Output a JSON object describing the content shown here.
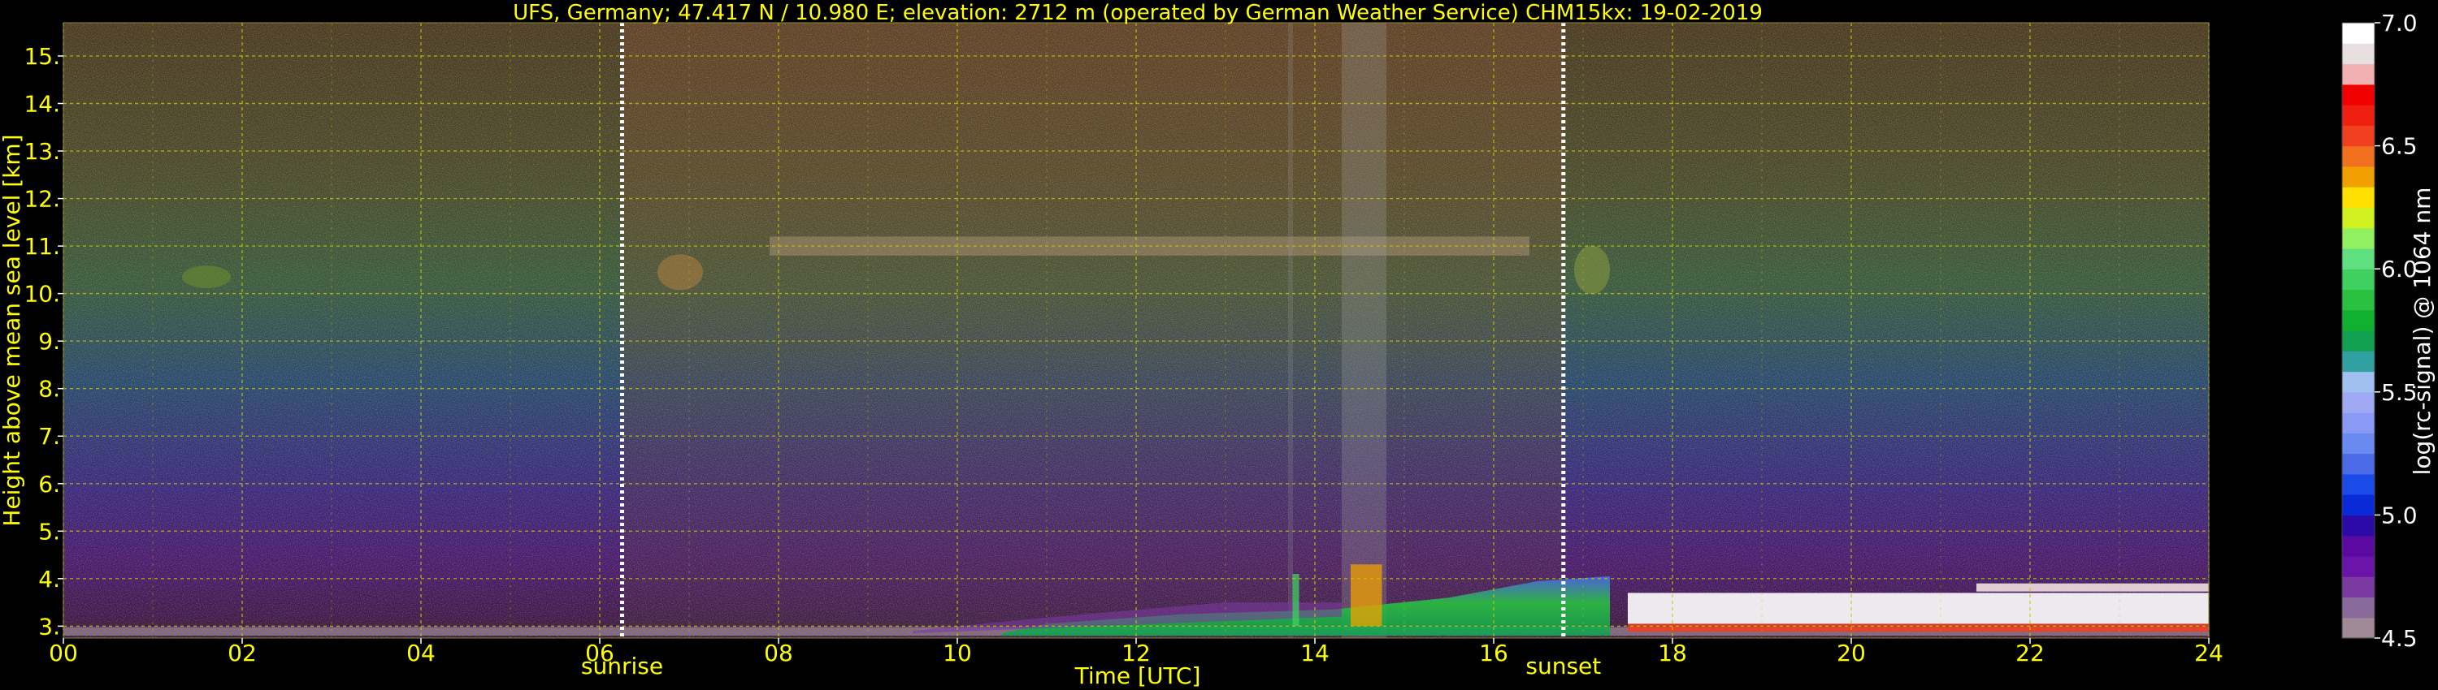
{
  "chart_data": {
    "type": "heatmap",
    "title": "UFS, Germany; 47.417 N / 10.980 E; elevation: 2712 m  (operated by German Weather Service)    CHM15kx: 19-02-2019",
    "xlabel": "Time [UTC]",
    "ylabel": "Height above mean sea level [km]",
    "colorbar_label": "log(rc-signal) @ 1064 nm",
    "xlim": [
      0,
      24
    ],
    "ylim": [
      2.75,
      15.7
    ],
    "x_ticks": [
      0,
      2,
      4,
      6,
      8,
      10,
      12,
      14,
      16,
      18,
      20,
      22,
      24
    ],
    "x_tick_labels": [
      "00",
      "02",
      "04",
      "06",
      "08",
      "10",
      "12",
      "14",
      "16",
      "18",
      "20",
      "22",
      "24"
    ],
    "y_ticks": [
      3,
      4,
      5,
      6,
      7,
      8,
      9,
      10,
      11,
      12,
      13,
      14,
      15
    ],
    "y_tick_labels": [
      "3.",
      "4.",
      "5.",
      "6.",
      "7.",
      "8.",
      "9.",
      "10.",
      "11.",
      "12.",
      "13.",
      "14.",
      "15."
    ],
    "colorbar_range": [
      4.5,
      7.0
    ],
    "colorbar_ticks": [
      4.5,
      5.0,
      5.5,
      6.0,
      6.5,
      7.0
    ],
    "colorbar_tick_labels": [
      "4.5",
      "5.0",
      "5.5",
      "6.0",
      "6.5",
      "7.0"
    ],
    "colormap": [
      "#a08a98",
      "#8a6a9a",
      "#7a3aa0",
      "#6a14a8",
      "#5a0aa0",
      "#2c0aa8",
      "#0a2ad8",
      "#1a4ae8",
      "#4a6ae8",
      "#6a8af0",
      "#8a9af4",
      "#a0aaf4",
      "#a0c0f0",
      "#30a0a0",
      "#10a050",
      "#10b030",
      "#2ac040",
      "#40d060",
      "#60e080",
      "#90f060",
      "#d0f020",
      "#ffe000",
      "#f0a000",
      "#f07020",
      "#f04020",
      "#f02010",
      "#f00000",
      "#f0b0b0",
      "#e8e0e0",
      "#ffffff"
    ],
    "sunrise": 6.25,
    "sunset": 16.78,
    "sun_labels": [
      "sunrise",
      "sunset"
    ],
    "grid": true,
    "text_color": "#ffff00",
    "features": {
      "cirrus_layer_km": [
        10.2,
        11.2
      ],
      "boundary_layer_top_km": 3.2,
      "low_cloud_after_utc": 17.5,
      "low_cloud_top_km": 3.9
    }
  }
}
